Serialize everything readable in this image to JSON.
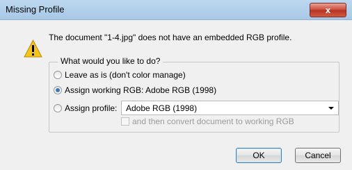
{
  "window": {
    "title": "Missing Profile",
    "close_label": "x"
  },
  "message": "The document \"1-4.jpg\" does not have an embedded RGB profile.",
  "group": {
    "legend": "What would you like to do?",
    "options": [
      {
        "label": "Leave as is (don't color manage)",
        "checked": false
      },
      {
        "label": "Assign working RGB:  Adobe RGB (1998)",
        "checked": true
      },
      {
        "label": "Assign profile:",
        "checked": false
      }
    ],
    "profile_select_value": "Adobe RGB (1998)",
    "convert_checkbox_label": "and then convert document to working RGB"
  },
  "buttons": {
    "ok": "OK",
    "cancel": "Cancel"
  },
  "colors": {
    "titlebar": "#bcd7ef",
    "close_button": "#c9493a",
    "dialog_background": "#f0f0f0",
    "warning_yellow": "#f3c51c"
  },
  "icons": {
    "warning": "warning-icon",
    "dropdown": "chevron-down-icon"
  }
}
